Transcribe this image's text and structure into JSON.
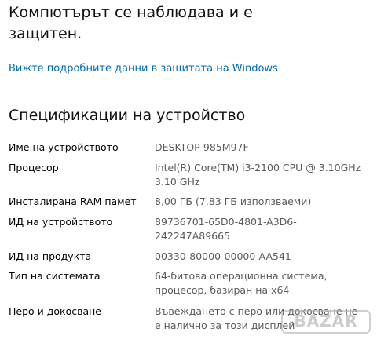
{
  "protection": {
    "heading": "Компютърът се наблюдава и е защитен.",
    "link_text": "Вижте подробните данни в защитата на Windows"
  },
  "specs": {
    "heading": "Спецификации на устройство",
    "rows": [
      {
        "label": "Име на устройството",
        "value": "DESKTOP-985M97F"
      },
      {
        "label": "Процесор",
        "value": "Intel(R) Core(TM) i3-2100 CPU @ 3.10GHz 3.10 GHz"
      },
      {
        "label": "Инсталирана RAM памет",
        "value": "8,00 ГБ (7,83 ГБ използваеми)"
      },
      {
        "label": "ИД на устройството",
        "value": "89736701-65D0-4801-A3D6-242247A89665"
      },
      {
        "label": "ИД на продукта",
        "value": "00330-80000-00000-AA541"
      },
      {
        "label": "Тип на системата",
        "value": "64-битова операционна система, процесор, базиран на x64"
      },
      {
        "label": "Перо и докосване",
        "value": "Въвеждането с перо или докосване не е налично за този дисплей"
      }
    ]
  },
  "watermark": "BAZAR"
}
